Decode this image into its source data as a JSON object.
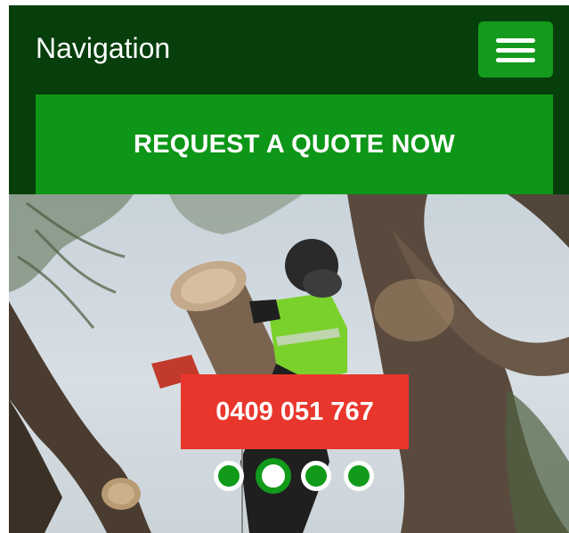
{
  "header": {
    "nav_title": "Navigation",
    "menu_icon": "hamburger-menu-icon",
    "quote_button": "REQUEST A QUOTE NOW"
  },
  "hero": {
    "phone": "0409 051 767",
    "slides": [
      {
        "label": "slide 1",
        "active": false
      },
      {
        "label": "slide 2",
        "active": true
      },
      {
        "label": "slide 3",
        "active": false
      },
      {
        "label": "slide 4",
        "active": false
      }
    ]
  },
  "colors": {
    "nav_background": "#063f0c",
    "brand_green": "#0d9617",
    "phone_red": "#e9362c"
  }
}
